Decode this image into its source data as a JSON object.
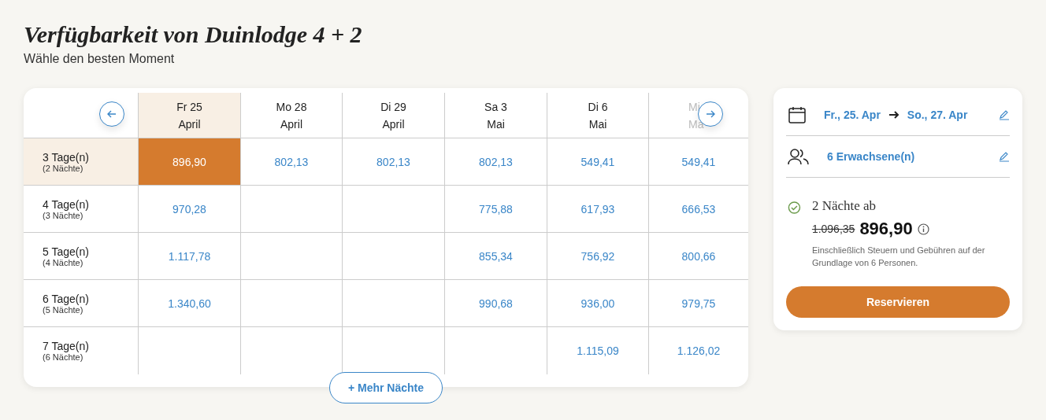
{
  "title": "Verfügbarkeit von Duinlodge 4 + 2",
  "subtitle": "Wähle den besten Moment",
  "columns": [
    {
      "day": "Fr 25",
      "month": "April",
      "selected": true,
      "faded": false
    },
    {
      "day": "Mo 28",
      "month": "April",
      "selected": false,
      "faded": false
    },
    {
      "day": "Di 29",
      "month": "April",
      "selected": false,
      "faded": false
    },
    {
      "day": "Sa 3",
      "month": "Mai",
      "selected": false,
      "faded": false
    },
    {
      "day": "Di 6",
      "month": "Mai",
      "selected": false,
      "faded": false
    },
    {
      "day": "Mi",
      "month": "Ma",
      "selected": false,
      "faded": true
    }
  ],
  "rows": [
    {
      "label": "3 Tage(n)",
      "sublabel": "(2 Nächte)",
      "selected": true,
      "cells": [
        {
          "price": "896,90",
          "selected": true
        },
        {
          "price": "802,13",
          "selected": false
        },
        {
          "price": "802,13",
          "selected": false
        },
        {
          "price": "802,13",
          "selected": false
        },
        {
          "price": "549,41",
          "selected": false
        },
        {
          "price": "549,41",
          "selected": false
        }
      ]
    },
    {
      "label": "4 Tage(n)",
      "sublabel": "(3 Nächte)",
      "selected": false,
      "cells": [
        {
          "price": "970,28",
          "selected": false
        },
        {
          "kind": "empty"
        },
        {
          "kind": "empty"
        },
        {
          "price": "775,88",
          "selected": false
        },
        {
          "price": "617,93",
          "selected": false
        },
        {
          "price": "666,53",
          "selected": false
        }
      ]
    },
    {
      "label": "5 Tage(n)",
      "sublabel": "(4 Nächte)",
      "selected": false,
      "cells": [
        {
          "price": "1.117,78",
          "selected": false
        },
        {
          "kind": "empty"
        },
        {
          "kind": "empty"
        },
        {
          "price": "855,34",
          "selected": false
        },
        {
          "price": "756,92",
          "selected": false
        },
        {
          "price": "800,66",
          "selected": false
        }
      ]
    },
    {
      "label": "6 Tage(n)",
      "sublabel": "(5 Nächte)",
      "selected": false,
      "cells": [
        {
          "price": "1.340,60",
          "selected": false
        },
        {
          "kind": "empty"
        },
        {
          "kind": "empty"
        },
        {
          "price": "990,68",
          "selected": false
        },
        {
          "price": "936,00",
          "selected": false
        },
        {
          "price": "979,75",
          "selected": false
        }
      ]
    },
    {
      "label": "7 Tage(n)",
      "sublabel": "(6 Nächte)",
      "selected": false,
      "cells": [
        {
          "kind": "empty"
        },
        {
          "kind": "empty"
        },
        {
          "kind": "empty"
        },
        {
          "kind": "empty"
        },
        {
          "price": "1.115,09",
          "selected": false
        },
        {
          "price": "1.126,02",
          "selected": false
        }
      ]
    }
  ],
  "more_button": "+ Mehr Nächte",
  "booking": {
    "date_from": "Fr., 25. Apr",
    "date_to": "So., 27. Apr",
    "guests": "6 Erwachsene(n)",
    "nights_label": "2 Nächte ab",
    "old_price": "1.096,35",
    "price": "896,90",
    "note": "Einschließlich Steuern und Gebühren auf der Grundlage von 6 Personen.",
    "button": "Reservieren"
  }
}
